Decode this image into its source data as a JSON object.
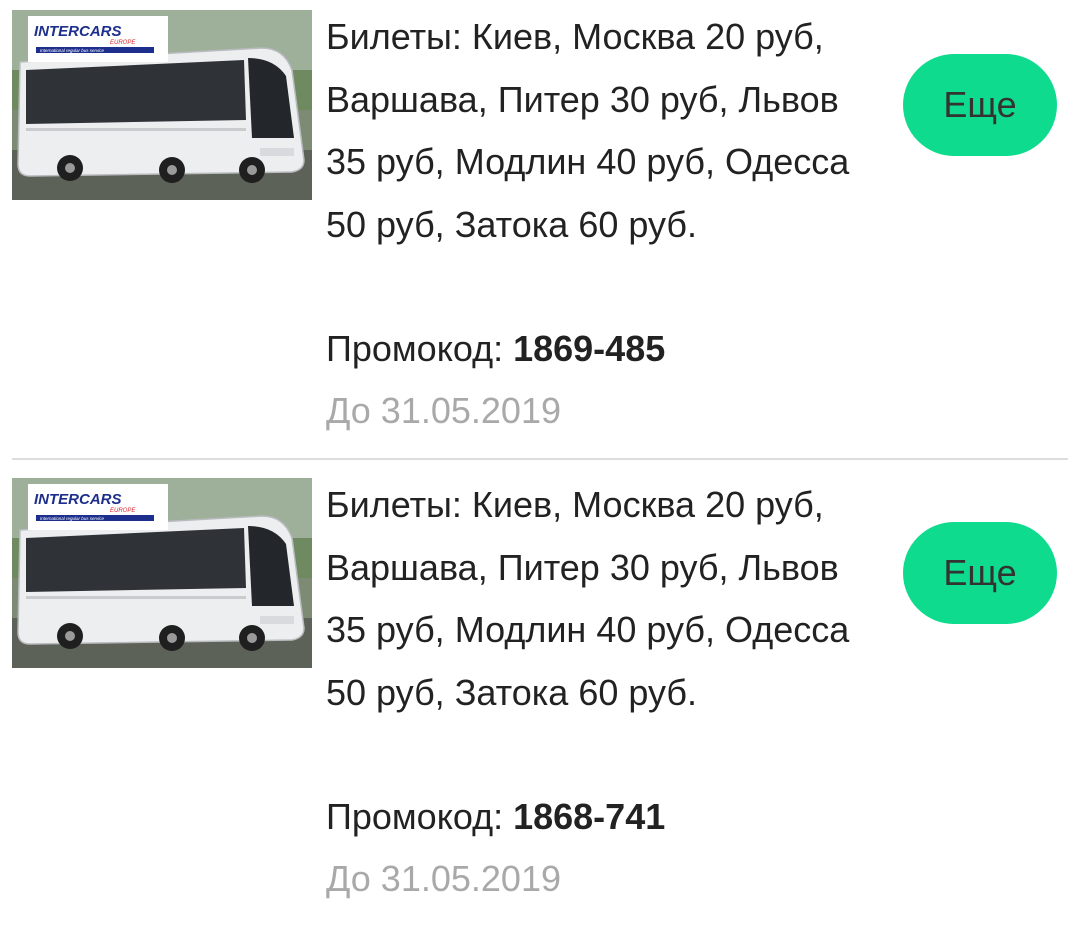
{
  "offers": [
    {
      "image_logo_text": "INTERCARS",
      "image_logo_subtext": "EUROPE",
      "image_logo_tagline": "International regular bus service",
      "description": "Билеты: Киев, Москва 20 руб, Варшава, Питер 30 руб, Львов 35 руб, Модлин 40 руб, Одесса 50 руб, Затока 60 руб.",
      "promo_label": "Промокод: ",
      "promo_code": "1869-485",
      "valid_until": "До 31.05.2019",
      "more_button": "Еще"
    },
    {
      "image_logo_text": "INTERCARS",
      "image_logo_subtext": "EUROPE",
      "image_logo_tagline": "International regular bus service",
      "description": "Билеты: Киев, Москва 20 руб, Варшава, Питер 30 руб, Львов 35 руб, Модлин 40 руб, Одесса 50 руб, Затока 60 руб.",
      "promo_label": "Промокод: ",
      "promo_code": "1868-741",
      "valid_until": "До 31.05.2019",
      "more_button": "Еще"
    }
  ],
  "colors": {
    "button_bg": "#0fdb8e",
    "text_primary": "#222222",
    "text_muted": "#a9a9a9",
    "divider": "#dddddd",
    "logo_blue": "#1d2f8c",
    "logo_red": "#d8262c"
  }
}
